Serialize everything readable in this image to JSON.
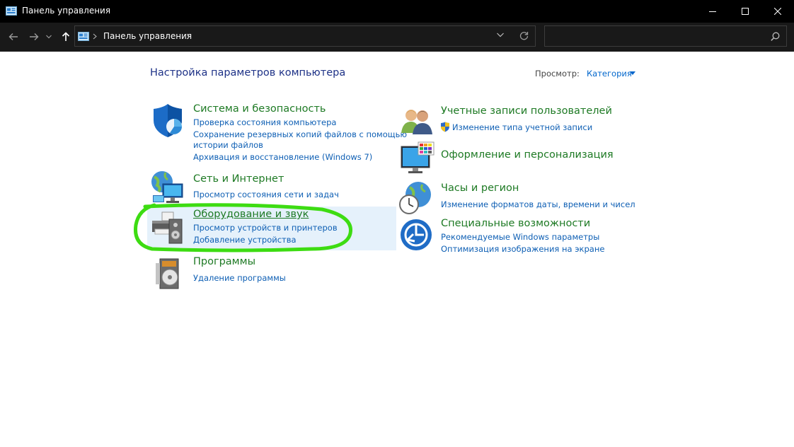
{
  "window": {
    "title": "Панель управления"
  },
  "address": {
    "breadcrumb": "Панель управления"
  },
  "search": {
    "placeholder": ""
  },
  "content": {
    "heading": "Настройка параметров компьютера",
    "view_label": "Просмотр:",
    "view_value": "Категория"
  },
  "categories": {
    "system": {
      "title": "Система и безопасность",
      "links": [
        "Проверка состояния компьютера",
        "Сохранение резервных копий файлов с помощью",
        "истории файлов",
        "Архивация и восстановление (Windows 7)"
      ]
    },
    "network": {
      "title": "Сеть и Интернет",
      "links": [
        "Просмотр состояния сети и задач"
      ]
    },
    "hardware": {
      "title": "Оборудование и звук",
      "links": [
        "Просмотр устройств и принтеров",
        "Добавление устройства"
      ]
    },
    "programs": {
      "title": "Программы",
      "links": [
        "Удаление программы"
      ]
    },
    "accounts": {
      "title": "Учетные записи пользователей",
      "links": [
        "Изменение типа учетной записи"
      ]
    },
    "appearance": {
      "title": "Оформление и персонализация",
      "links": []
    },
    "clock": {
      "title": "Часы и регион",
      "links": [
        "Изменение форматов даты, времени и чисел"
      ]
    },
    "access": {
      "title": "Специальные возможности",
      "links": [
        "Рекомендуемые Windows параметры",
        "Оптимизация изображения на экране"
      ]
    }
  },
  "colors": {
    "titlebar": "#000000",
    "navbar": "#191919",
    "category_title": "#1e7a24",
    "link": "#0e5fb4",
    "heading": "#1e3287",
    "highlight_annotation": "#3ddc12"
  }
}
